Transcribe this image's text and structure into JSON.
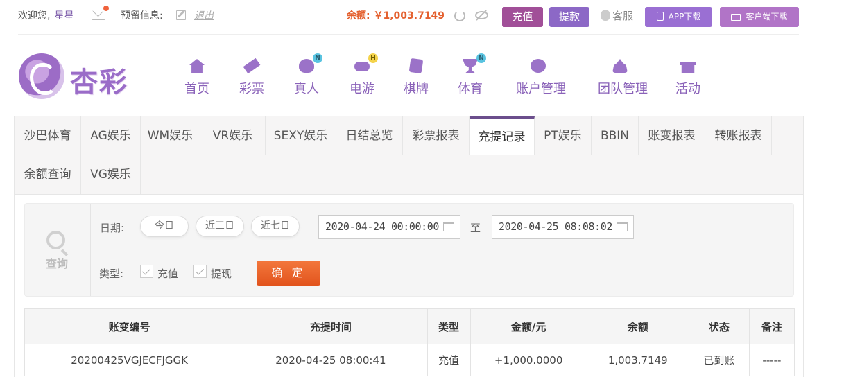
{
  "topbar": {
    "welcome": "欢迎您,",
    "username": "星星",
    "reserve_label": "预留信息:",
    "logout": "退出",
    "balance": "余额: ￥1,003.7149",
    "deposit": "充值",
    "withdraw": "提款",
    "service": "客服",
    "app_download": "APP下载",
    "client_download": "客户端下载",
    "colors": {
      "balance": "#e4602e",
      "deposit_btn": "#a14f98",
      "withdraw_btn": "#8c68c6",
      "app_btn": "#9a6fd3",
      "client_btn": "#b174c7"
    }
  },
  "logo": {
    "text": "杏彩"
  },
  "nav": [
    {
      "label": "首页",
      "icon": "home-icon"
    },
    {
      "label": "彩票",
      "icon": "lottery-ticket-icon"
    },
    {
      "label": "真人",
      "icon": "live-dealer-icon",
      "badge": "N"
    },
    {
      "label": "电游",
      "icon": "gamepad-icon",
      "badge": "H"
    },
    {
      "label": "棋牌",
      "icon": "cards-icon"
    },
    {
      "label": "体育",
      "icon": "trophy-icon",
      "badge": "N"
    },
    {
      "label": "账户管理",
      "icon": "yen-coin-icon"
    },
    {
      "label": "团队管理",
      "icon": "team-icon"
    },
    {
      "label": "活动",
      "icon": "gift-icon"
    }
  ],
  "tabs": [
    "沙巴体育",
    "AG娱乐",
    "WM娱乐",
    "VR娱乐",
    "SEXY娱乐",
    "日结总览",
    "彩票报表",
    "充提记录",
    "PT娱乐",
    "BBIN",
    "账变报表",
    "转账报表",
    "余额查询",
    "VG娱乐"
  ],
  "active_tab": "充提记录",
  "filter": {
    "query_label": "查询",
    "date_label": "日期:",
    "quick": [
      "今日",
      "近三日",
      "近七日"
    ],
    "start": "2020-04-24 00:00:00",
    "to": "至",
    "end": "2020-04-25 08:08:02",
    "type_label": "类型:",
    "types": [
      {
        "label": "充值",
        "checked": false
      },
      {
        "label": "提现",
        "checked": false
      }
    ],
    "confirm": "确 定"
  },
  "table": {
    "headers": [
      "账变编号",
      "充提时间",
      "类型",
      "金额/元",
      "余额",
      "状态",
      "备注"
    ],
    "rows": [
      [
        "20200425VGJECFJGGK",
        "2020-04-25 08:00:41",
        "充值",
        "+1,000.0000",
        "1,003.7149",
        "已到账",
        "-----"
      ]
    ]
  }
}
